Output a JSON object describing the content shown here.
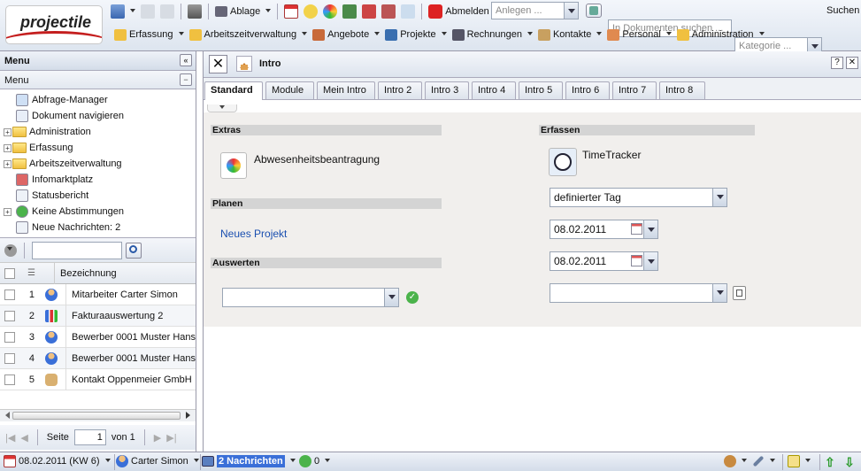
{
  "brand": {
    "logo_text": "projectile"
  },
  "toolbar1": {
    "ablage": "Ablage",
    "abmelden": "Abmelden",
    "anlegen_placeholder": "Anlegen ...",
    "search_placeholder": "In Dokumenten suchen ...",
    "kategorie_placeholder": "Kategorie ...",
    "suchen": "Suchen"
  },
  "menubar": [
    "Erfassung",
    "Arbeitszeitverwaltung",
    "Angebote",
    "Projekte",
    "Rechnungen",
    "Kontakte",
    "Personal",
    "Administration"
  ],
  "left": {
    "panel_title": "Menu",
    "sub_title": "Menu",
    "tree": [
      {
        "label": "Abfrage-Manager",
        "expand": false
      },
      {
        "label": "Dokument navigieren",
        "expand": false
      },
      {
        "label": "Administration",
        "expand": true
      },
      {
        "label": "Erfassung",
        "expand": true
      },
      {
        "label": "Arbeitszeitverwaltung",
        "expand": true
      },
      {
        "label": "Infomarktplatz",
        "expand": false
      },
      {
        "label": "Statusbericht",
        "expand": false
      },
      {
        "label": "Keine Abstimmungen",
        "expand": true
      },
      {
        "label": "Neue Nachrichten: 2",
        "expand": false
      }
    ],
    "grid_header": "Bezeichnung",
    "rows": [
      {
        "n": "1",
        "label": "Mitarbeiter Carter Simon"
      },
      {
        "n": "2",
        "label": "Fakturaauswertung 2"
      },
      {
        "n": "3",
        "label": "Bewerber 0001 Muster Hans"
      },
      {
        "n": "4",
        "label": "Bewerber 0001 Muster Hans"
      },
      {
        "n": "5",
        "label": "Kontakt Oppenmeier GmbH"
      }
    ],
    "pager": {
      "seite": "Seite",
      "page": "1",
      "von": "von 1"
    }
  },
  "main": {
    "title": "Intro",
    "tabs": [
      "Standard",
      "Module",
      "Mein Intro",
      "Intro 2",
      "Intro 3",
      "Intro 4",
      "Intro 5",
      "Intro 6",
      "Intro 7",
      "Intro 8"
    ],
    "extras": "Extras",
    "abwesenheit": "Abwesenheitsbeantragung",
    "planen": "Planen",
    "neues_projekt": "Neues Projekt",
    "auswerten": "Auswerten",
    "erfassen": "Erfassen",
    "timetracker": "TimeTracker",
    "day_select": "definierter Tag",
    "date1": "08.02.2011",
    "date2": "08.02.2011"
  },
  "status": {
    "date": "08.02.2011 (KW 6)",
    "user": "Carter Simon",
    "messages": "2 Nachrichten",
    "count": "0"
  },
  "colors": {
    "link": "#1a4fb0",
    "selected": "#3a6fd8",
    "logo_red": "#c41e1e"
  }
}
